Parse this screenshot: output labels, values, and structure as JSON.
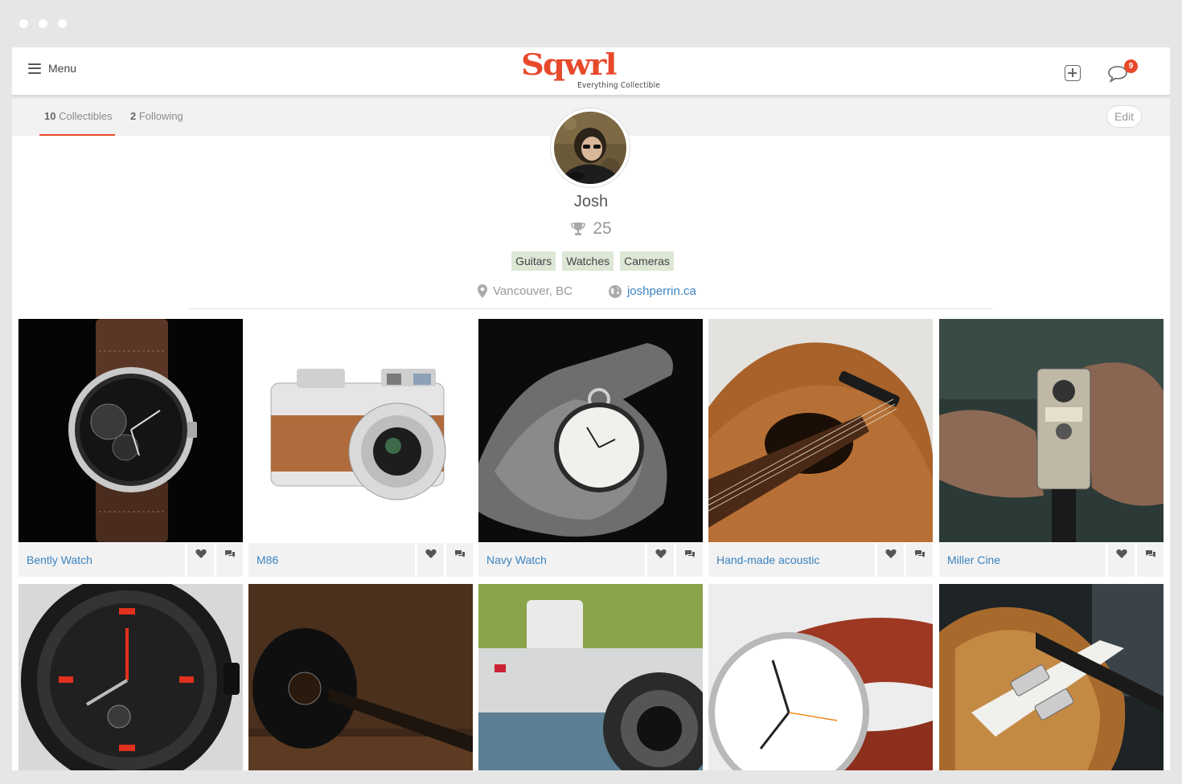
{
  "header": {
    "menu_label": "Menu",
    "logo_text": "Sqwrl",
    "logo_tagline": "Everything Collectible",
    "notification_count": "9"
  },
  "subnav": {
    "collectibles_count": "10",
    "collectibles_label": "Collectibles",
    "following_count": "2",
    "following_label": "Following",
    "edit_label": "Edit"
  },
  "profile": {
    "name": "Josh",
    "score": "25",
    "tags": [
      "Guitars",
      "Watches",
      "Cameras"
    ],
    "location": "Vancouver, BC",
    "website": "joshperrin.ca"
  },
  "collectibles": [
    {
      "title": "Bently Watch",
      "image": "watch-leather"
    },
    {
      "title": "M86",
      "image": "camera-silver"
    },
    {
      "title": "Navy Watch",
      "image": "pocket-watch"
    },
    {
      "title": "Hand-made acoustic",
      "image": "acoustic-guitar"
    },
    {
      "title": "Miller Cine",
      "image": "cine-camera"
    },
    {
      "title": "",
      "image": "dive-watch"
    },
    {
      "title": "",
      "image": "black-guitar"
    },
    {
      "title": "",
      "image": "outdoor-camera"
    },
    {
      "title": "",
      "image": "minimal-watch"
    },
    {
      "title": "",
      "image": "electric-guitar"
    }
  ],
  "colors": {
    "brand": "#e8492b",
    "link": "#3b83c0",
    "tag_bg": "#dde7d6"
  }
}
